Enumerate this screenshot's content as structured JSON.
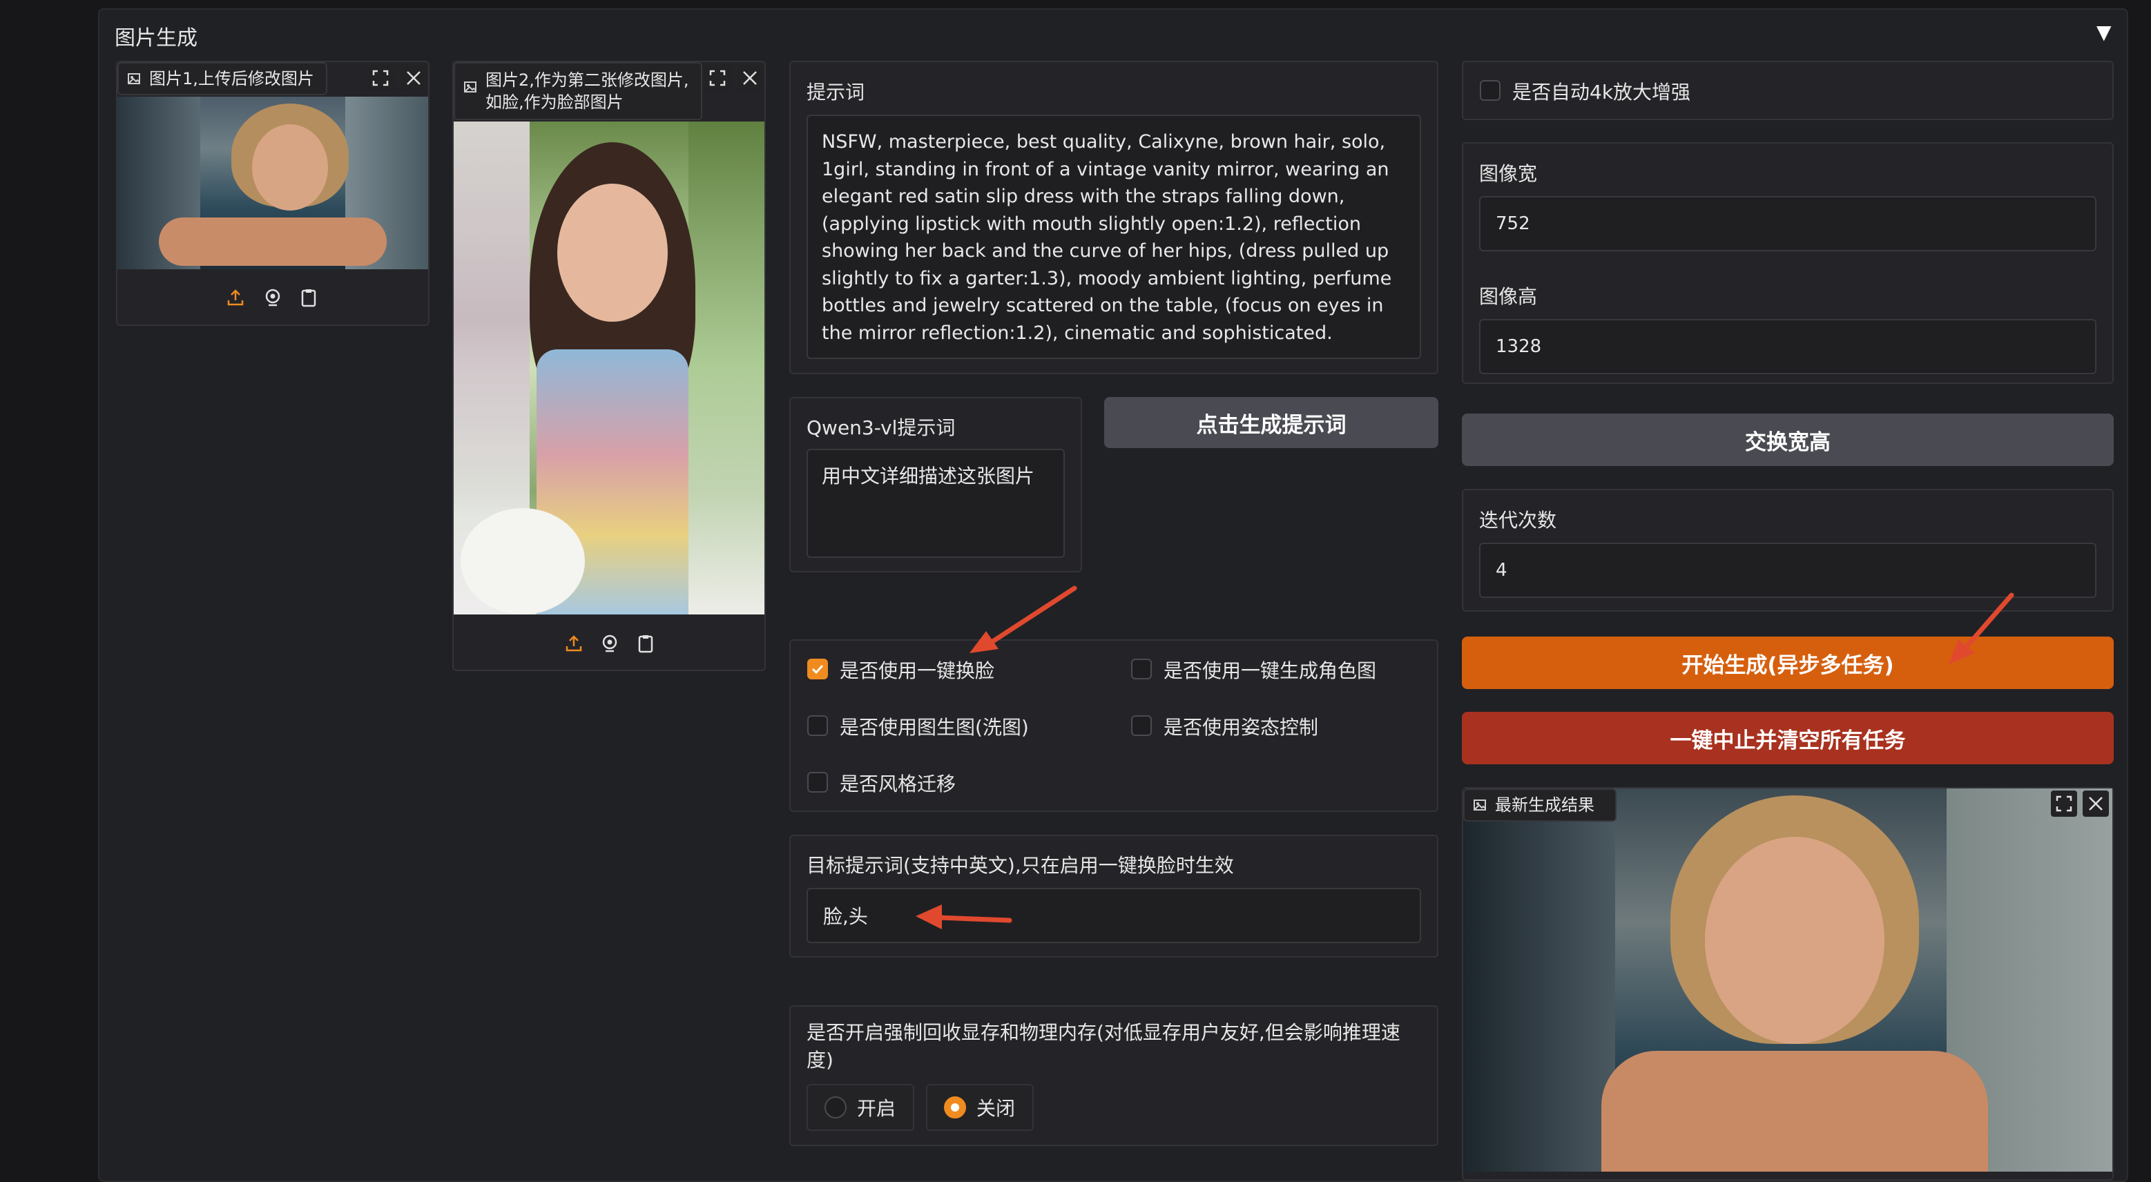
{
  "panel": {
    "title": "图片生成",
    "collapse_icon": "triangle-down-icon"
  },
  "image1": {
    "label": "图片1,上传后修改图片"
  },
  "image2": {
    "label": "图片2,作为第二张修改图片,如脸,作为脸部图片"
  },
  "prompt": {
    "label": "提示词",
    "text": "NSFW, masterpiece, best quality, Calixyne, brown hair, solo, 1girl, standing in front of a vintage vanity mirror, wearing an elegant red satin slip dress with the straps falling down, (applying lipstick with mouth slightly open:1.2), reflection showing her back and the curve of her hips, (dress pulled up slightly to fix a garter:1.3), moody ambient lighting, perfume bottles and jewelry scattered on the table, (focus on eyes in the mirror reflection:1.2), cinematic and sophisticated."
  },
  "qwen": {
    "label": "Qwen3-vl提示词",
    "value": "用中文详细描述这张图片"
  },
  "generate_prompt_button": "点击生成提示词",
  "options": {
    "face_swap": "是否使用一键换脸",
    "character_image": "是否使用一键生成角色图",
    "img2img": "是否使用图生图(洗图)",
    "pose_control": "是否使用姿态控制",
    "style_transfer": "是否风格迁移"
  },
  "target_prompt": {
    "label": "目标提示词(支持中英文),只在启用一键换脸时生效",
    "value": "脸,头"
  },
  "memory": {
    "label": "是否开启强制回收显存和物理内存(对低显存用户友好,但会影响推理速度)",
    "on": "开启",
    "off": "关闭"
  },
  "upscale": {
    "label": "是否自动4k放大增强"
  },
  "width": {
    "label": "图像宽",
    "value": "752"
  },
  "height": {
    "label": "图像高",
    "value": "1328"
  },
  "swap_button": "交换宽高",
  "iterations": {
    "label": "迭代次数",
    "value": "4"
  },
  "start_button": "开始生成(异步多任务)",
  "stop_button": "一键中止并清空所有任务",
  "result": {
    "label": "最新生成结果"
  },
  "colors": {
    "accent": "#f08b1f",
    "start": "#d65f0e",
    "stop": "#a8321f",
    "arrow": "#e0492e"
  }
}
